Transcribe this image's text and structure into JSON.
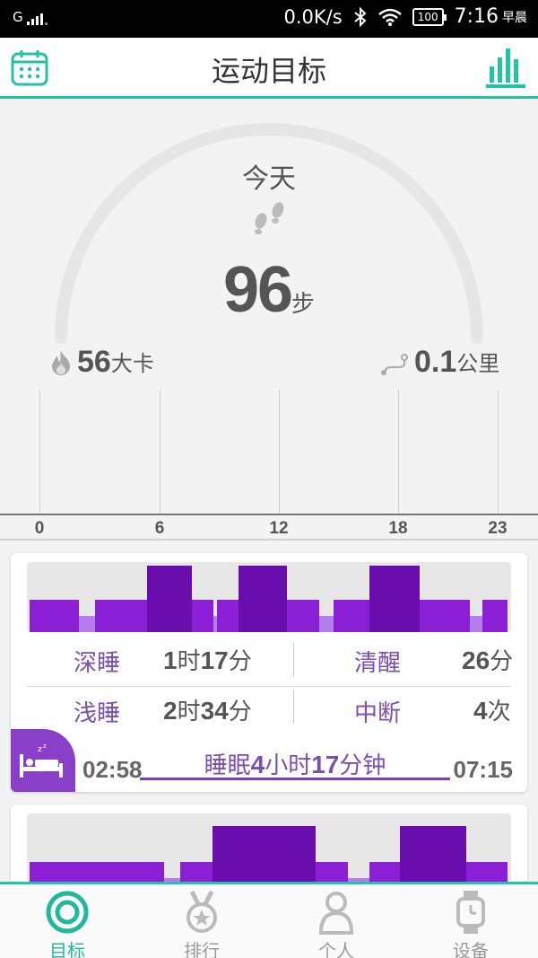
{
  "status_bar": {
    "signal": "G",
    "network_speed": "0.0K/s",
    "battery": "100",
    "time": "7:16",
    "ampm": "早晨"
  },
  "header": {
    "title": "运动目标",
    "left_icon": "calendar-icon",
    "right_icon": "bar-chart-icon"
  },
  "summary": {
    "today_label": "今天",
    "steps_value": "96",
    "steps_unit": "步",
    "calories_value": "56",
    "calories_unit": "大卡",
    "distance_value": "0.1",
    "distance_unit": "公里"
  },
  "hour_ticks": [
    "0",
    "6",
    "12",
    "18",
    "23"
  ],
  "sleep": {
    "deep_label": "深睡",
    "deep_hours": "1",
    "deep_mins": "17",
    "awake_label": "清醒",
    "awake_mins": "26",
    "light_label": "浅睡",
    "light_hours": "2",
    "light_mins": "34",
    "interrupt_label": "中断",
    "interrupt_count": "4",
    "unit_hour": "时",
    "unit_min": "分",
    "unit_times": "次",
    "start_time": "02:58",
    "end_time": "07:15",
    "total_prefix": "睡眠",
    "total_hours": "4",
    "total_hour_unit": "小时",
    "total_mins": "17",
    "total_min_unit": "分钟"
  },
  "colors": {
    "accent": "#22c4a6",
    "deep_sleep": "#6a0dad",
    "light_sleep": "#8b1fd6",
    "awake": "#b57cf0"
  },
  "bottom_nav": [
    {
      "label": "目标",
      "icon": "target-icon",
      "active": true
    },
    {
      "label": "排行",
      "icon": "medal-icon",
      "active": false
    },
    {
      "label": "个人",
      "icon": "person-icon",
      "active": false
    },
    {
      "label": "设备",
      "icon": "watch-icon",
      "active": false
    }
  ]
}
